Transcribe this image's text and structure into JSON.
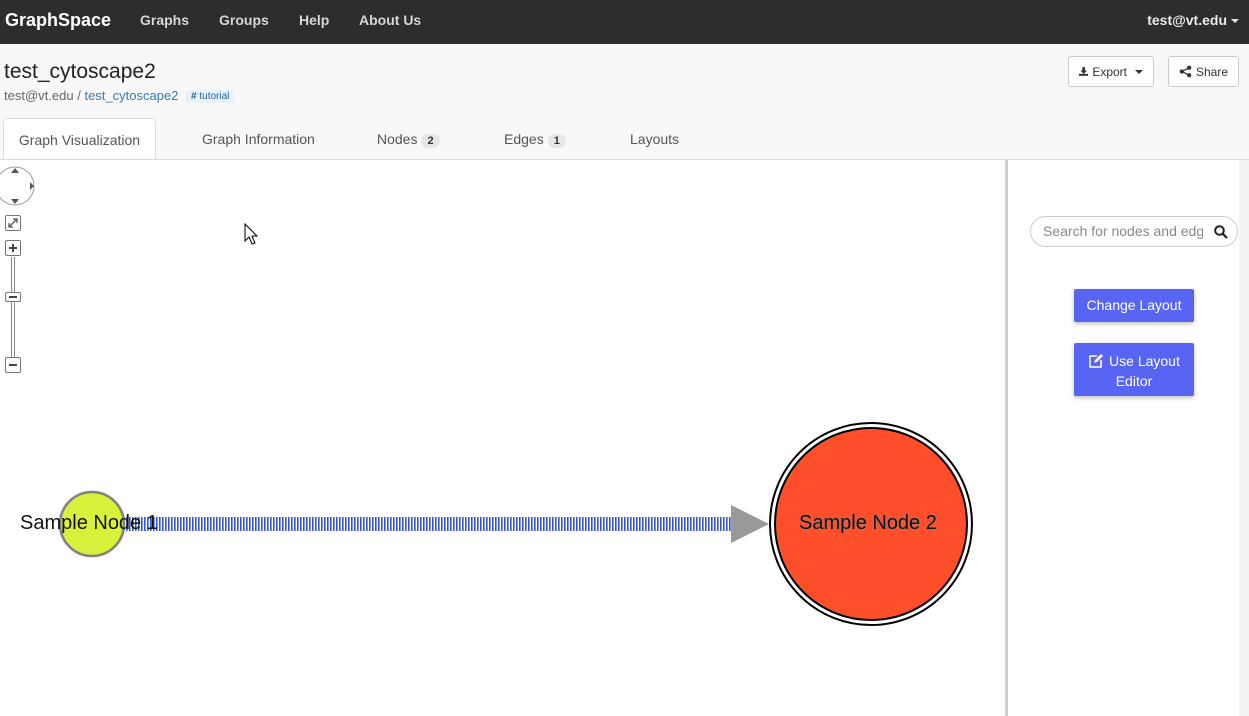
{
  "nav": {
    "brand": "GraphSpace",
    "links": [
      "Graphs",
      "Groups",
      "Help",
      "About Us"
    ],
    "user": "test@vt.edu"
  },
  "header": {
    "title": "test_cytoscape2",
    "owner": "test@vt.edu",
    "separator": "/",
    "graph_link": "test_cytoscape2",
    "tag": "tutorial",
    "export_label": "Export",
    "share_label": "Share"
  },
  "tabs": [
    {
      "label": "Graph Visualization"
    },
    {
      "label": "Graph Information"
    },
    {
      "label": "Nodes",
      "count": "2"
    },
    {
      "label": "Edges",
      "count": "1"
    },
    {
      "label": "Layouts"
    }
  ],
  "graph": {
    "nodes": [
      {
        "label": "Sample Node 1",
        "color": "#d8f03a"
      },
      {
        "label": "Sample Node 2",
        "color": "#ff4e2a"
      }
    ],
    "edge": {
      "source": "Sample Node 1",
      "target": "Sample Node 2",
      "color": "#3656c8",
      "arrow_color": "#999999"
    }
  },
  "sidebar": {
    "search_placeholder": "Search for nodes and edges",
    "change_layout_label": "Change Layout",
    "layout_editor_label": "Use Layout Editor"
  },
  "colors": {
    "navbar": "#2b2d2f",
    "primary_button": "#5865f2",
    "link": "#337ab7"
  }
}
